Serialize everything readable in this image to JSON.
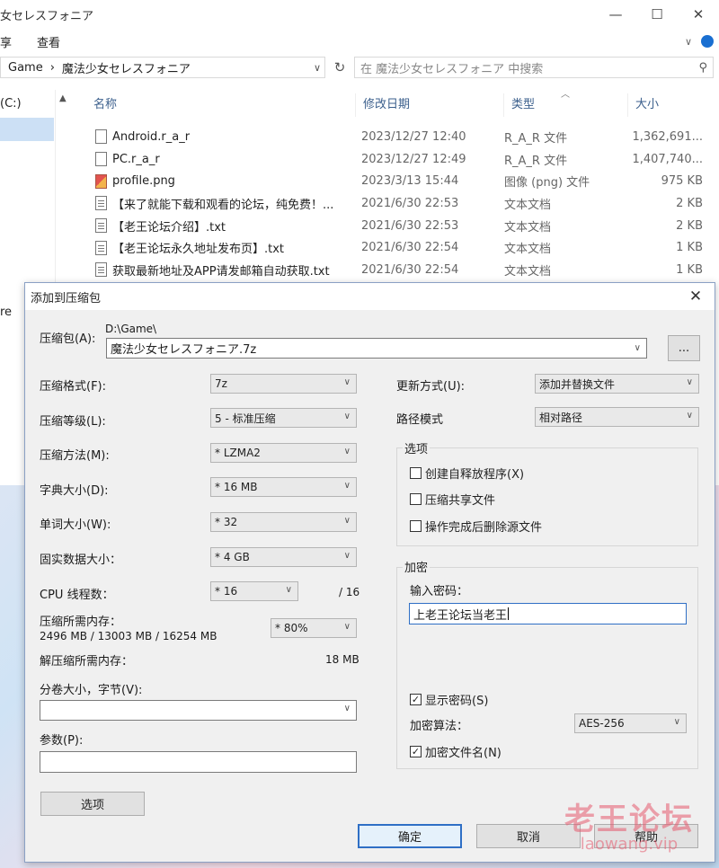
{
  "explorer": {
    "title": "女セレスフォニア",
    "window_controls": {
      "minimize": "—",
      "maximize": "☐",
      "close": "✕"
    },
    "ribbon": {
      "share": "享",
      "view": "查看"
    },
    "breadcrumb": [
      "Game",
      "魔法少女セレスフォニア"
    ],
    "breadcrumb_sep": "›",
    "search_placeholder": "在 魔法少女セレスフォニア 中搜索",
    "nav": {
      "drive": "(C:)",
      "tail": "re"
    },
    "columns": {
      "name": "名称",
      "date": "修改日期",
      "type": "类型",
      "size": "大小"
    },
    "files": [
      {
        "name": "Android.r_a_r",
        "date": "2023/12/27 12:40",
        "type": "R_A_R 文件",
        "size": "1,362,691...",
        "icon": "file-icon"
      },
      {
        "name": "PC.r_a_r",
        "date": "2023/12/27 12:49",
        "type": "R_A_R 文件",
        "size": "1,407,740...",
        "icon": "file-icon"
      },
      {
        "name": "profile.png",
        "date": "2023/3/13 15:44",
        "type": "图像 (png) 文件",
        "size": "975 KB",
        "icon": "image-icon"
      },
      {
        "name": "【来了就能下载和观看的论坛，纯免费！...",
        "date": "2021/6/30 22:53",
        "type": "文本文档",
        "size": "2 KB",
        "icon": "text-file-icon"
      },
      {
        "name": "【老王论坛介绍】.txt",
        "date": "2021/6/30 22:53",
        "type": "文本文档",
        "size": "2 KB",
        "icon": "text-file-icon"
      },
      {
        "name": "【老王论坛永久地址发布页】.txt",
        "date": "2021/6/30 22:54",
        "type": "文本文档",
        "size": "1 KB",
        "icon": "text-file-icon"
      },
      {
        "name": "获取最新地址及APP请发邮箱自动获取.txt",
        "date": "2021/6/30 22:54",
        "type": "文本文档",
        "size": "1 KB",
        "icon": "text-file-icon"
      }
    ]
  },
  "dialog": {
    "title": "添加到压缩包",
    "close": "✕",
    "archive_label": "压缩包(A):",
    "archive_path": "D:\\Game\\",
    "archive_name": "魔法少女セレスフォニア.7z",
    "browse_label": "...",
    "format_label": "压缩格式(F):",
    "format_value": "7z",
    "level_label": "压缩等级(L):",
    "level_value": "5 - 标准压缩",
    "method_label": "压缩方法(M):",
    "method_value": "* LZMA2",
    "dict_label": "字典大小(D):",
    "dict_value": "* 16 MB",
    "word_label": "单词大小(W):",
    "word_value": "* 32",
    "solid_label": "固实数据大小：",
    "solid_value": "* 4 GB",
    "cpu_label": "CPU 线程数：",
    "cpu_value": "* 16",
    "cpu_max": "/ 16",
    "mem_label": "压缩所需内存：",
    "mem_detail": "2496 MB / 13003 MB / 16254 MB",
    "mem_pct": "* 80%",
    "decomp_label": "解压缩所需内存：",
    "decomp_value": "18 MB",
    "split_label": "分卷大小，字节(V):",
    "split_value": "",
    "params_label": "参数(P):",
    "params_value": "",
    "options_button": "选项",
    "update_label": "更新方式(U):",
    "update_value": "添加并替换文件",
    "path_label": "路径模式",
    "path_value": "相对路径",
    "options_group": "选项",
    "opt_sfx": "创建自释放程序(X)",
    "opt_shared": "压缩共享文件",
    "opt_delete": "操作完成后删除源文件",
    "encrypt_group": "加密",
    "password_label": "输入密码：",
    "password_value": "上老王论坛当老王",
    "show_password": "显示密码(S)",
    "enc_method_label": "加密算法：",
    "enc_method_value": "AES-256",
    "encrypt_names": "加密文件名(N)",
    "ok": "确定",
    "cancel": "取消",
    "help": "帮助"
  },
  "watermark": {
    "text": "老王论坛",
    "url": "laowang.vip"
  }
}
